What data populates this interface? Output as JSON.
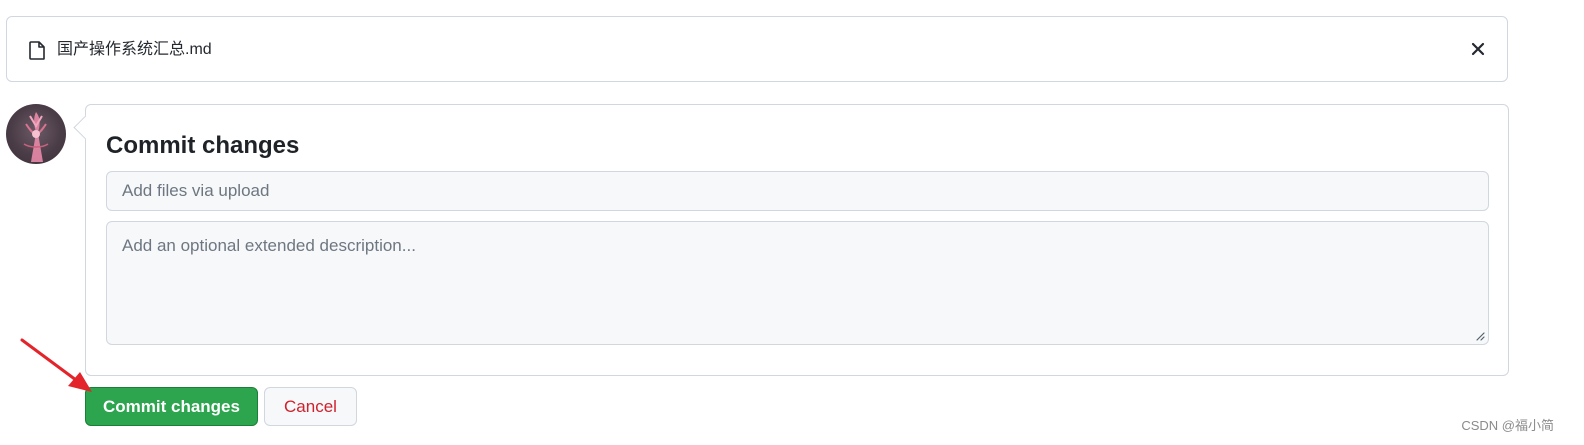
{
  "file": {
    "name": "国产操作系统汇总.md",
    "icon": "file-icon",
    "close_icon": "close-icon"
  },
  "avatar": {
    "icon": "user-avatar"
  },
  "commit": {
    "title": "Commit changes",
    "summary_placeholder": "Add files via upload",
    "summary_value": "",
    "description_placeholder": "Add an optional extended description...",
    "description_value": ""
  },
  "buttons": {
    "commit_label": "Commit changes",
    "cancel_label": "Cancel"
  },
  "colors": {
    "commit_button": "#2da44e",
    "cancel_text": "#cf222e",
    "annotation_arrow": "#e3242b"
  },
  "watermark": "CSDN @福小简"
}
